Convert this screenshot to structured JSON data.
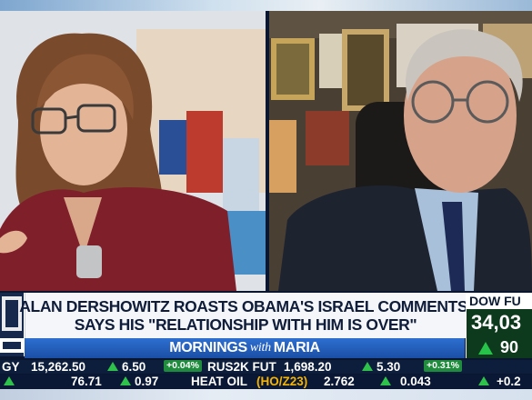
{
  "lower_third": {
    "network_logo_text": "FOX BUSINESS NETWORK",
    "headline_line1": "ALAN DERSHOWITZ ROASTS OBAMA'S ISRAEL COMMENTS,",
    "headline_line2": "SAYS HIS \"RELATIONSHIP WITH HIM IS OVER\"",
    "show_name_1": "MORNINGS",
    "show_name_with": "with",
    "show_name_2": "MARIA"
  },
  "dow": {
    "label": "DOW FU",
    "value": "34,03",
    "change": "90",
    "direction": "up"
  },
  "ticker_row_1": {
    "t1": "GY",
    "v1": "15,262.50",
    "c1": "6.50",
    "p1": "+0.04%",
    "t2": "RUS2K FUT",
    "v2": "1,698.20",
    "c2": "5.30",
    "p2": "+0.31%"
  },
  "ticker_row_2": {
    "t1": "76.71",
    "c1": "0.97",
    "t2": "HEAT OIL",
    "t2b": "(HO/Z23)",
    "v2": "2.762",
    "c2": "0.043",
    "tail": "+0.2"
  },
  "colors": {
    "headline_bg": "#f4f6f9",
    "showbar_blue": "#2d6fd0",
    "up_green": "#2ec24b",
    "navy": "#0b1a33"
  }
}
